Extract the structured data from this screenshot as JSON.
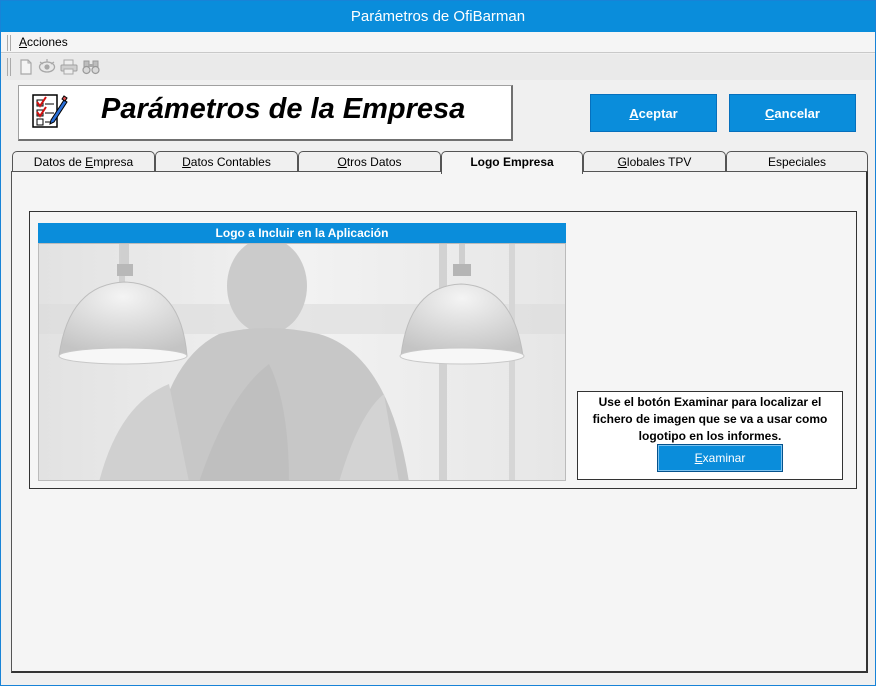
{
  "window": {
    "title": "Parámetros de OfiBarman"
  },
  "menu": {
    "acciones": "Acciones"
  },
  "toolbar": {
    "icons": [
      "new-document-icon",
      "preview-eye-icon",
      "print-icon",
      "find-binoculars-icon"
    ]
  },
  "header": {
    "title": "Parámetros de la Empresa"
  },
  "buttons": {
    "aceptar": {
      "underline": "A",
      "rest": "ceptar"
    },
    "cancelar": {
      "underline": "C",
      "rest": "ancelar"
    }
  },
  "tabs": [
    {
      "pre": "Datos de ",
      "u": "E",
      "post": "mpresa",
      "active": false
    },
    {
      "pre": "",
      "u": "D",
      "post": "atos Contables",
      "active": false
    },
    {
      "pre": "",
      "u": "O",
      "post": "tros Datos",
      "active": false
    },
    {
      "pre": "Logo Empresa",
      "u": "",
      "post": "",
      "active": true
    },
    {
      "pre": "",
      "u": "G",
      "post": "lobales TPV",
      "active": false
    },
    {
      "pre": "Especiales",
      "u": "",
      "post": "",
      "active": false
    }
  ],
  "logo": {
    "header": "Logo a Incluir en la Aplicación"
  },
  "info": {
    "text": "Use el botón Examinar para localizar el fichero de imagen que se va a usar como logotipo en los informes.",
    "examinar": {
      "underline": "E",
      "rest": "xaminar"
    }
  },
  "colors": {
    "accent": "#0a8ddb"
  }
}
